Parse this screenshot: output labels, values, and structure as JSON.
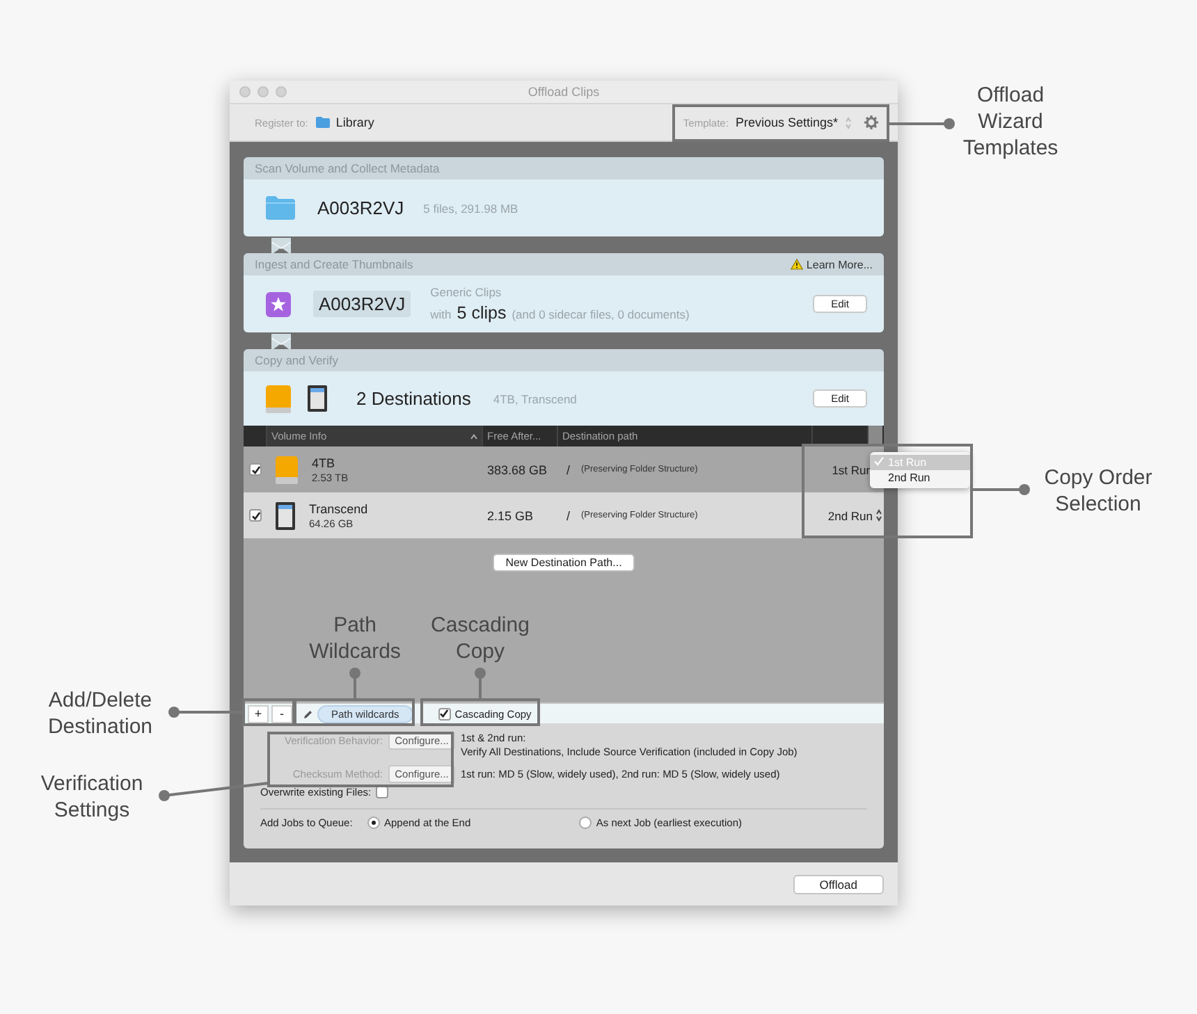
{
  "window": {
    "title": "Offload Clips"
  },
  "toolbar": {
    "register_label": "Register to:",
    "register_value": "Library",
    "template_label": "Template:",
    "template_value": "Previous Settings*"
  },
  "steps": [
    {
      "kind": "scan",
      "title": "Scan Volume and Collect Metadata",
      "name": "A003R2VJ",
      "detail": "5 files, 291.98 MB"
    },
    {
      "kind": "ingest",
      "title": "Ingest and Create Thumbnails",
      "link": "Learn More...",
      "name": "A003R2VJ",
      "type_line": "Generic Clips",
      "with": "with",
      "count": "5 clips",
      "extra": "(and 0 sidecar files, 0 documents)",
      "button": "Edit"
    },
    {
      "kind": "copy",
      "title": "Copy and Verify",
      "summary": "2 Destinations",
      "detail": "4TB, Transcend",
      "button": "Edit"
    }
  ],
  "destinations": {
    "columns": [
      "Volume Info",
      "Free After...",
      "Destination path"
    ],
    "rows": [
      {
        "kind": "drive",
        "selected": true,
        "checked": true,
        "name": "4TB",
        "size": "2.53 TB",
        "free": "383.68 GB",
        "path": "/",
        "note": "(Preserving Folder Structure)",
        "run": "1st Run"
      },
      {
        "kind": "card",
        "selected": false,
        "checked": true,
        "name": "Transcend",
        "size": "64.26 GB",
        "free": "2.15 GB",
        "path": "/",
        "note": "(Preserving Folder Structure)",
        "run": "2nd Run"
      }
    ],
    "new_button": "New Destination Path..."
  },
  "run_menu": {
    "options": [
      {
        "label": "1st Run",
        "selected": true
      },
      {
        "label": "2nd Run",
        "selected": false
      }
    ]
  },
  "bottom_toolbar": {
    "add": "+",
    "remove": "-",
    "wildcards": "Path wildcards",
    "cascading": {
      "label": "Cascading Copy",
      "checked": true
    }
  },
  "settings": {
    "verification_label": "Verification Behavior:",
    "verification_button": "Configure...",
    "verification_lines": [
      "1st & 2nd run:",
      "Verify All Destinations, Include Source Verification (included in Copy Job)"
    ],
    "checksum_label": "Checksum Method:",
    "checksum_button": "Configure...",
    "checksum_text": "1st run: MD 5 (Slow, widely used), 2nd run: MD 5 (Slow, widely used)",
    "overwrite": {
      "label": "Overwrite existing Files:",
      "checked": false
    },
    "queue": {
      "label": "Add Jobs to Queue:",
      "options": [
        {
          "label": "Append at the End",
          "selected": true
        },
        {
          "label": "As next Job (earliest execution)",
          "selected": false
        }
      ]
    }
  },
  "footer": {
    "button": "Offload"
  },
  "annotations": [
    {
      "text": "Offload\nWizard\nTemplates"
    },
    {
      "text": "Copy Order\nSelection"
    },
    {
      "text": "Path\nWildcards"
    },
    {
      "text": "Cascading\nCopy"
    },
    {
      "text": "Add/Delete\nDestination"
    },
    {
      "text": "Verification\nSettings"
    }
  ]
}
